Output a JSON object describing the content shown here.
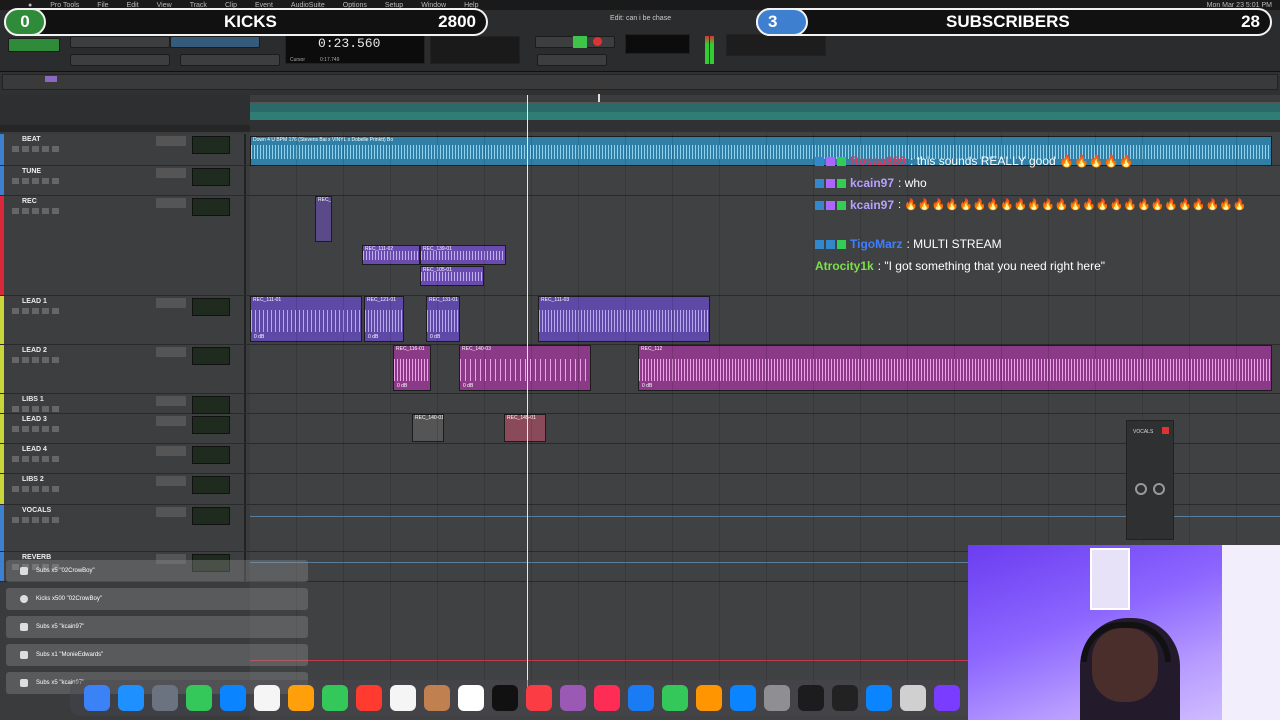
{
  "menubar": {
    "app": "Pro Tools",
    "items": [
      "File",
      "Edit",
      "View",
      "Track",
      "Clip",
      "Event",
      "AudioSuite",
      "Options",
      "Setup",
      "Window",
      "Help"
    ],
    "clock": "Mon Mar 23  5:01 PM"
  },
  "banner_left": {
    "count": "0",
    "label": "KICKS",
    "value": "2800"
  },
  "banner_right": {
    "count": "3",
    "label": "SUBSCRIBERS",
    "value": "28"
  },
  "transport": {
    "counter": "0:23.560",
    "edit_window_title": "Edit: can i be chase",
    "counter_label": "Cursor",
    "cursor_value": "0:17.749"
  },
  "tracks": [
    {
      "name": "BEAT",
      "color": "#3f7fd0"
    },
    {
      "name": "TUNE",
      "color": "#3f7fd0"
    },
    {
      "name": "REC",
      "color": "#d8283a"
    },
    {
      "name": "LEAD 1",
      "color": "#c9d63a"
    },
    {
      "name": "LEAD 2",
      "color": "#c9d63a"
    },
    {
      "name": "LIBS 1",
      "color": "#c9d63a"
    },
    {
      "name": "LEAD 3",
      "color": "#c9d63a"
    },
    {
      "name": "LEAD 4",
      "color": "#c9d63a"
    },
    {
      "name": "LIBS 2",
      "color": "#c9d63a"
    },
    {
      "name": "VOCALS",
      "color": "#3f7fd0"
    },
    {
      "name": "REVERB",
      "color": "#3f7fd0"
    }
  ],
  "clips": {
    "beat": "Down 4 U BPM 176 (Stevens Bai x VINYL x Dobelle Prinktt) Bo",
    "rec_a": "REC_",
    "rec_b": "REC_111-02",
    "rec_c": "REC_139-01",
    "rec_d": "REC_105-01",
    "lead1_a": "REC_111-01",
    "lead1_b": "REC_121-01",
    "lead1_c": "REC_131-01",
    "lead1_d": "REC_111-03",
    "lead2_a": "REC_116-01",
    "lead2_b": "REC_140-03",
    "lead2_c": "REC_112",
    "lead3_a": "REC_140-01",
    "lead3_b": "REC_145-01",
    "db": "0 dB"
  },
  "chat": [
    {
      "user": "Rosaa889",
      "user_color": "#e0385a",
      "msg": ": this sounds REALLY good 🔥🔥🔥🔥🔥"
    },
    {
      "user": "kcain97",
      "user_color": "#b8a0ff",
      "msg": ": who"
    },
    {
      "user": "kcain97",
      "user_color": "#b8a0ff",
      "msg": ": 🔥🔥🔥🔥🔥🔥🔥🔥🔥🔥🔥🔥🔥🔥🔥🔥🔥🔥🔥🔥🔥🔥🔥🔥🔥"
    },
    {
      "user": "TigoMarz",
      "user_color": "#3f7fff",
      "msg": ": MULTI STREAM"
    },
    {
      "user": "Atrocity1k",
      "user_color": "#7be04a",
      "msg": ": \"I got something that you need right here\""
    }
  ],
  "alerts": [
    "Subs x5 \"02CrowBoy\"",
    "Kicks x500 \"02CrowBoy\"",
    "Subs x5 \"kcain97\"",
    "Subs x1 \"MonieEdwards\"",
    "Subs x5 \"kcain97\""
  ],
  "mini_window": {
    "title": "VOCALS"
  },
  "colors": {
    "accent": "#2f8a3a",
    "playhead": "#e8e8e8",
    "beat_clip": "#2f7fa6",
    "rec_clip": "#6a4bb0",
    "lead2_clip": "#8a3a86"
  }
}
